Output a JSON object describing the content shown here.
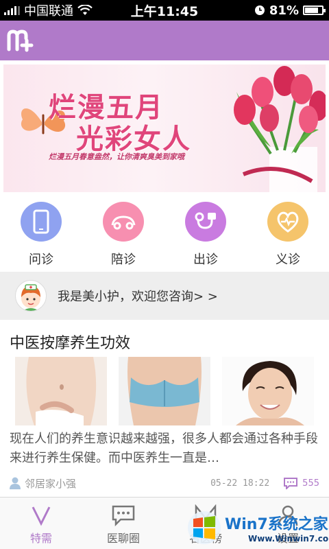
{
  "status_bar": {
    "carrier": "中国联通",
    "time": "上午11:45",
    "battery": "81%",
    "battery_level": 0.81
  },
  "banner": {
    "title_line1": "烂漫五月",
    "title_line2": "光彩女人",
    "subtitle": "烂漫五月春意盎然，让你清爽臭美到家哦"
  },
  "services": [
    {
      "label": "问诊",
      "icon": "phone-icon",
      "color": "#8fa2f0"
    },
    {
      "label": "陪诊",
      "icon": "car-icon",
      "color": "#f78fb0"
    },
    {
      "label": "出诊",
      "icon": "medical-plug-icon",
      "color": "#c97be0"
    },
    {
      "label": "义诊",
      "icon": "heart-pulse-icon",
      "color": "#f5c46b"
    }
  ],
  "assistant": {
    "text": "我是美小护，欢迎您咨询> >"
  },
  "article": {
    "title": "中医按摩养生功效",
    "body": "现在人们的养生意识越来越强，很多人都会通过各种手段来进行养生保健。而中医养生一直是…",
    "author": "邻居家小强",
    "time": "05-22  18:22",
    "comments": "555"
  },
  "tabs": [
    {
      "label": "特需",
      "icon": "v-icon",
      "active": true
    },
    {
      "label": "医聊圈",
      "icon": "chat-icon",
      "active": false
    },
    {
      "label": "名医榜",
      "icon": "m-icon",
      "active": false
    },
    {
      "label": "设置",
      "icon": "person-icon",
      "active": false
    }
  ],
  "watermark": {
    "text": "Win7系统之家",
    "url": "Www.Winwin7.com"
  },
  "colors": {
    "brand": "#b07ac9",
    "banner_pink": "#e0457b"
  }
}
